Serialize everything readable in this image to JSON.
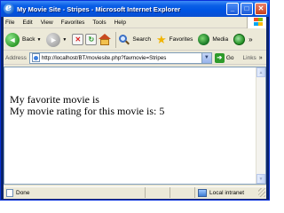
{
  "window": {
    "title": "My Movie Site - Stripes - Microsoft Internet Explorer",
    "controls": {
      "minimize": "_",
      "maximize": "□",
      "close": "✕"
    }
  },
  "menubar": {
    "items": [
      "File",
      "Edit",
      "View",
      "Favorites",
      "Tools",
      "Help"
    ]
  },
  "toolbar": {
    "back_label": "Back",
    "search_label": "Search",
    "favorites_label": "Favorites",
    "media_label": "Media",
    "more": "»"
  },
  "addressbar": {
    "label": "Address",
    "url": "http://localhost/BT/moviesite.php?favmovie=Stripes",
    "go_label": "Go",
    "links_label": "Links",
    "links_more": "»"
  },
  "content": {
    "line1": "My favorite movie is",
    "line2": "My movie rating for this movie is: 5"
  },
  "statusbar": {
    "status": "Done",
    "zone": "Local intranet"
  },
  "colors": {
    "titlebar": "#0054e3",
    "chrome": "#ece9d8",
    "page_bg": "#ffffff"
  }
}
